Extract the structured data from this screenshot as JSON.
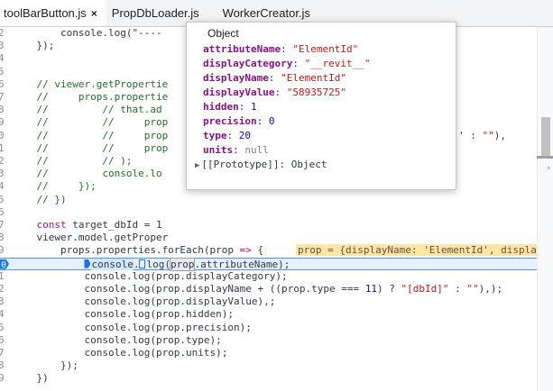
{
  "tabs": [
    {
      "label": "toolBarButton.js",
      "active": true,
      "close": "×"
    },
    {
      "label": "PropDbLoader.js",
      "active": false
    },
    {
      "label": "WorkerCreator.js",
      "active": false
    }
  ],
  "code_lines": [
    {
      "ln": "2",
      "text": "        console.log(\"----"
    },
    {
      "ln": "3",
      "text": "    });"
    },
    {
      "ln": "4",
      "text": ""
    },
    {
      "ln": "5",
      "text": ""
    },
    {
      "ln": "6",
      "text": "    // viewer.getPropertie"
    },
    {
      "ln": "7",
      "text": "    //     props.propertie"
    },
    {
      "ln": "8",
      "text": "    //         // that.ad"
    },
    {
      "ln": "9",
      "text": "    //         //     prop"
    },
    {
      "ln": "0",
      "text": "    //         //     prop"
    },
    {
      "ln": "1",
      "text": "    //         //     prop"
    },
    {
      "ln": "2",
      "text": "    //         // );"
    },
    {
      "ln": "3",
      "text": "    //         console.lo"
    },
    {
      "ln": "4",
      "text": "    //     });"
    },
    {
      "ln": "5",
      "text": "    // })"
    },
    {
      "ln": "6",
      "text": ""
    },
    {
      "ln": "7",
      "text": "    const target_dbId = 1"
    },
    {
      "ln": "8",
      "text": "    viewer.model.getProper"
    },
    {
      "ln": "9",
      "text": "        props.properties.forEach(prop => {"
    },
    {
      "ln": "0",
      "text": "            console.log(prop.attributeName);"
    },
    {
      "ln": "1",
      "text": "            console.log(prop.displayCategory);"
    },
    {
      "ln": "2",
      "text": "            console.log(prop.displayName + ((prop.type === 11) ? \"[dbId]\" : \"\"),);"
    },
    {
      "ln": "3",
      "text": "            console.log(prop.displayValue),;"
    },
    {
      "ln": "4",
      "text": "            console.log(prop.hidden);"
    },
    {
      "ln": "5",
      "text": "            console.log(prop.precision);"
    },
    {
      "ln": "6",
      "text": "            console.log(prop.type);"
    },
    {
      "ln": "7",
      "text": "            console.log(prop.units);"
    },
    {
      "ln": "8",
      "text": "        });"
    },
    {
      "ln": "9",
      "text": "    })"
    }
  ],
  "right_fragments": {
    "line9_suffix": "' : \"\"),",
    "inline_value": "prop = {displayName: 'ElementId', displa"
  },
  "popover": {
    "title": "Object",
    "props": [
      {
        "key": "attributeName",
        "value": "\"ElementId\"",
        "kind": "str"
      },
      {
        "key": "displayCategory",
        "value": "\"__revit__\"",
        "kind": "str"
      },
      {
        "key": "displayName",
        "value": "\"ElementId\"",
        "kind": "str"
      },
      {
        "key": "displayValue",
        "value": "\"58935725\"",
        "kind": "str"
      },
      {
        "key": "hidden",
        "value": "1",
        "kind": "num"
      },
      {
        "key": "precision",
        "value": "0",
        "kind": "num"
      },
      {
        "key": "type",
        "value": "20",
        "kind": "num"
      },
      {
        "key": "units",
        "value": "null",
        "kind": "null"
      }
    ],
    "prototype": "[[Prototype]]: Object"
  },
  "breakpoint_line": "0",
  "scroll_marker": "‹"
}
